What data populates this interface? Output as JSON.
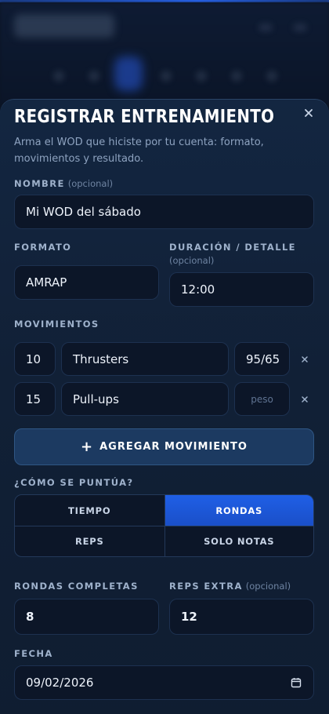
{
  "sheet": {
    "title": "REGISTRAR ENTRENAMIENTO",
    "subtitle": "Arma el WOD que hiciste por tu cuenta: formato, movimientos y resultado."
  },
  "name": {
    "label": "NOMBRE",
    "optional": "(opcional)",
    "value": "Mi WOD del sábado"
  },
  "format": {
    "label": "FORMATO",
    "value": "AMRAP"
  },
  "duration": {
    "label": "DURACIÓN / DETALLE",
    "optional": "(opcional)",
    "value": "12:00"
  },
  "movements": {
    "label": "MOVIMIENTOS",
    "items": [
      {
        "reps": "10",
        "name": "Thrusters",
        "weight": "95/65",
        "weight_placeholder": ""
      },
      {
        "reps": "15",
        "name": "Pull-ups",
        "weight": "",
        "weight_placeholder": "peso"
      }
    ],
    "add_label": "AGREGAR MOVIMIENTO"
  },
  "scoring": {
    "label": "¿CÓMO SE PUNTÚA?",
    "options": [
      "TIEMPO",
      "RONDAS",
      "REPS",
      "SOLO NOTAS"
    ],
    "selected": "RONDAS"
  },
  "rounds": {
    "label": "RONDAS COMPLETAS",
    "value": "8"
  },
  "extra_reps": {
    "label": "REPS EXTRA",
    "optional": "(opcional)",
    "value": "12"
  },
  "date": {
    "label": "FECHA",
    "value": "09/02/2026"
  },
  "icons": {
    "close": "close-icon",
    "remove": "close-icon",
    "add": "plus-icon",
    "calendar": "calendar-icon"
  },
  "colors": {
    "accent": "#1f5fe6",
    "background": "#0b1424",
    "sheet": "#112036"
  }
}
